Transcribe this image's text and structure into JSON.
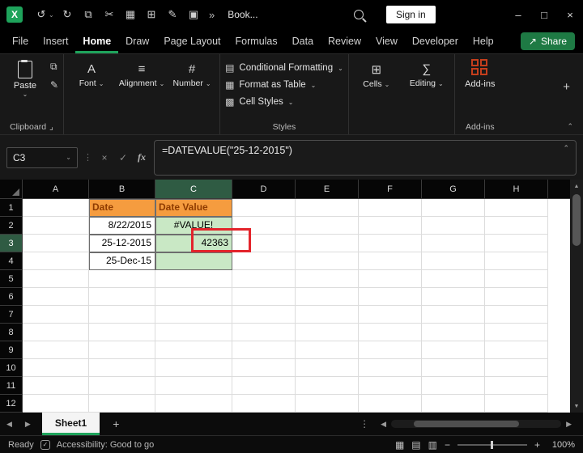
{
  "titlebar": {
    "document_title": "Book...",
    "sign_in": "Sign in"
  },
  "menubar": {
    "items": [
      "File",
      "Insert",
      "Home",
      "Draw",
      "Page Layout",
      "Formulas",
      "Data",
      "Review",
      "View",
      "Developer",
      "Help"
    ],
    "active": "Home",
    "share_label": "Share"
  },
  "ribbon": {
    "paste": "Paste",
    "clipboard_group": "Clipboard",
    "font": "Font",
    "alignment": "Alignment",
    "number": "Number",
    "conditional_formatting": "Conditional Formatting",
    "format_as_table": "Format as Table",
    "cell_styles": "Cell Styles",
    "styles_group": "Styles",
    "cells": "Cells",
    "editing": "Editing",
    "addins": "Add-ins",
    "addins_group": "Add-ins"
  },
  "formula_bar": {
    "name_box": "C3",
    "formula": "=DATEVALUE(\"25-12-2015\")"
  },
  "grid": {
    "column_headers": [
      "A",
      "B",
      "C",
      "D",
      "E",
      "F",
      "G",
      "H"
    ],
    "row_headers": [
      "1",
      "2",
      "3",
      "4",
      "5",
      "6",
      "7",
      "8",
      "9",
      "10",
      "11",
      "12"
    ],
    "selected_column": "C",
    "selected_row": "3",
    "cells": {
      "B1": {
        "text": "Date",
        "fill": "orange",
        "align": "left",
        "bold": true,
        "table": true
      },
      "C1": {
        "text": "Date Value",
        "fill": "orange",
        "align": "left",
        "bold": true,
        "table": true
      },
      "B2": {
        "text": "8/22/2015",
        "align": "right",
        "table": true
      },
      "C2": {
        "text": "#VALUE!",
        "fill": "green",
        "align": "center",
        "table": true
      },
      "B3": {
        "text": "25-12-2015",
        "align": "right",
        "table": true
      },
      "C3": {
        "text": "42363",
        "fill": "green",
        "align": "right",
        "table": true
      },
      "B4": {
        "text": "25-Dec-15",
        "align": "right",
        "table": true
      },
      "C4": {
        "text": "",
        "fill": "green",
        "table": true
      }
    }
  },
  "tabs": {
    "active_tab": "Sheet1"
  },
  "status": {
    "mode": "Ready",
    "accessibility": "Accessibility: Good to go",
    "zoom": "100%"
  },
  "colors": {
    "accent_green": "#1EA35B",
    "header_fill_orange": "#F59C3F",
    "value_fill_green": "#C9E8C5",
    "annotation_red": "#E3242B"
  },
  "icons": {
    "excel_logo": "X",
    "undo": "↺",
    "redo": "↻",
    "copy": "⧉",
    "cut": "✂",
    "chart": "▦",
    "table": "⊞",
    "edit": "✎",
    "cells_grid": "▣",
    "overflow": "»",
    "chevron_down": "⌄",
    "chevron_up": "⌃",
    "minimize": "–",
    "maximize": "□",
    "close": "×",
    "cancel": "×",
    "check": "✓",
    "fx": "fx",
    "font": "A",
    "alignment": "≡",
    "number": "#",
    "cond_format": "▤",
    "format_table": "▦",
    "cell_styles": "▩",
    "cells": "⊞",
    "editing": "∑",
    "share": "↗",
    "dialog_launcher": "⌟",
    "left": "◀",
    "right": "▶",
    "up": "▲",
    "down": "▼",
    "dots": "⋮",
    "plus": "+",
    "view_normal": "▦",
    "view_layout": "▤",
    "view_break": "▥",
    "zoom_out": "−",
    "zoom_in": "+",
    "accessibility_check": "✓"
  }
}
